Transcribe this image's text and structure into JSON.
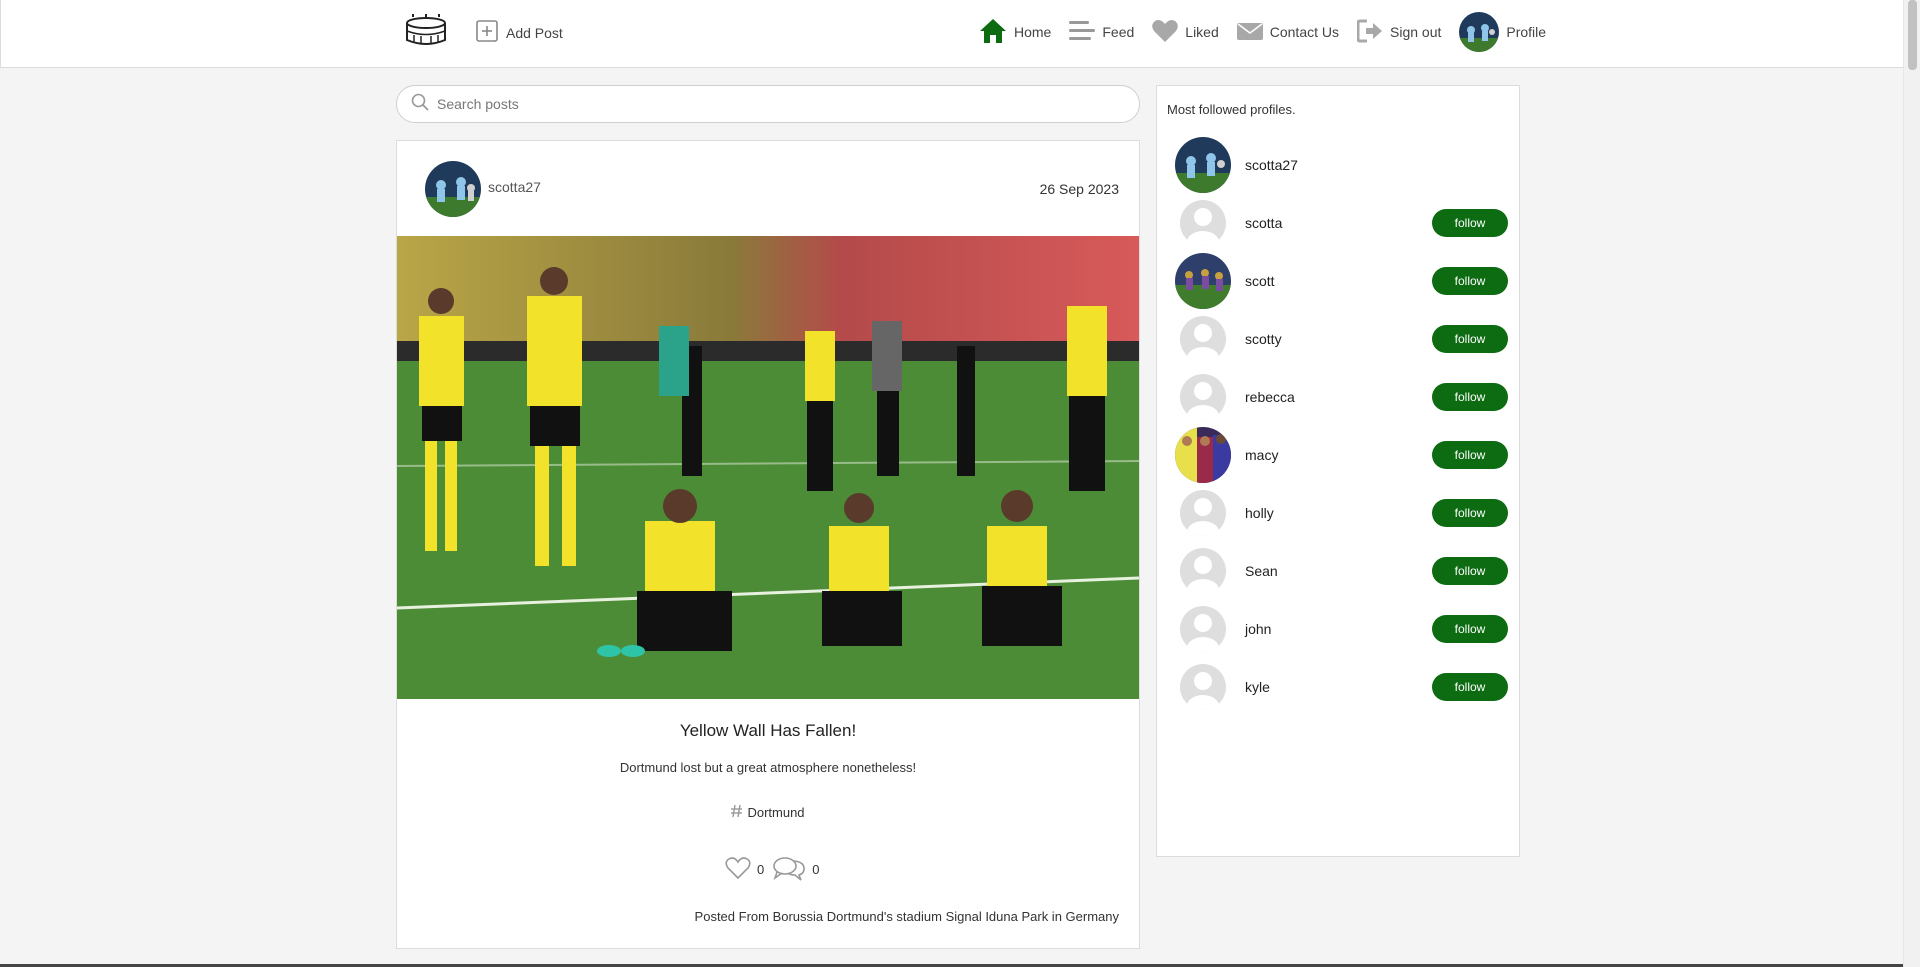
{
  "nav": {
    "add_post": "Add Post",
    "home": "Home",
    "feed": "Feed",
    "liked": "Liked",
    "contact": "Contact Us",
    "signout": "Sign out",
    "profile": "Profile"
  },
  "search": {
    "placeholder": "Search posts"
  },
  "post": {
    "username": "scotta27",
    "date": "26 Sep 2023",
    "title": "Yellow Wall Has Fallen!",
    "description": "Dortmund lost but a great atmosphere nonetheless!",
    "tag": "Dortmund",
    "likes": "0",
    "comments": "0",
    "location": "Posted From Borussia Dortmund's stadium Signal Iduna Park in Germany"
  },
  "sidebar": {
    "title": "Most followed profiles.",
    "follow_label": "follow",
    "profiles": [
      {
        "name": "scotta27"
      },
      {
        "name": "scotta"
      },
      {
        "name": "scott"
      },
      {
        "name": "scotty"
      },
      {
        "name": "rebecca"
      },
      {
        "name": "macy"
      },
      {
        "name": "holly"
      },
      {
        "name": "Sean"
      },
      {
        "name": "john"
      },
      {
        "name": "kyle"
      }
    ]
  },
  "colors": {
    "accent_green": "#0d6b12",
    "background": "#f4f4f4",
    "card": "#ffffff"
  },
  "icons": {
    "logo": "stadium-icon",
    "add": "plus-square-icon",
    "home": "home-icon",
    "feed": "list-icon",
    "liked": "heart-icon",
    "contact": "envelope-icon",
    "signout": "sign-out-icon",
    "search": "search-icon",
    "tag": "hashtag-icon",
    "like": "heart-outline-icon",
    "comment": "comments-icon"
  }
}
